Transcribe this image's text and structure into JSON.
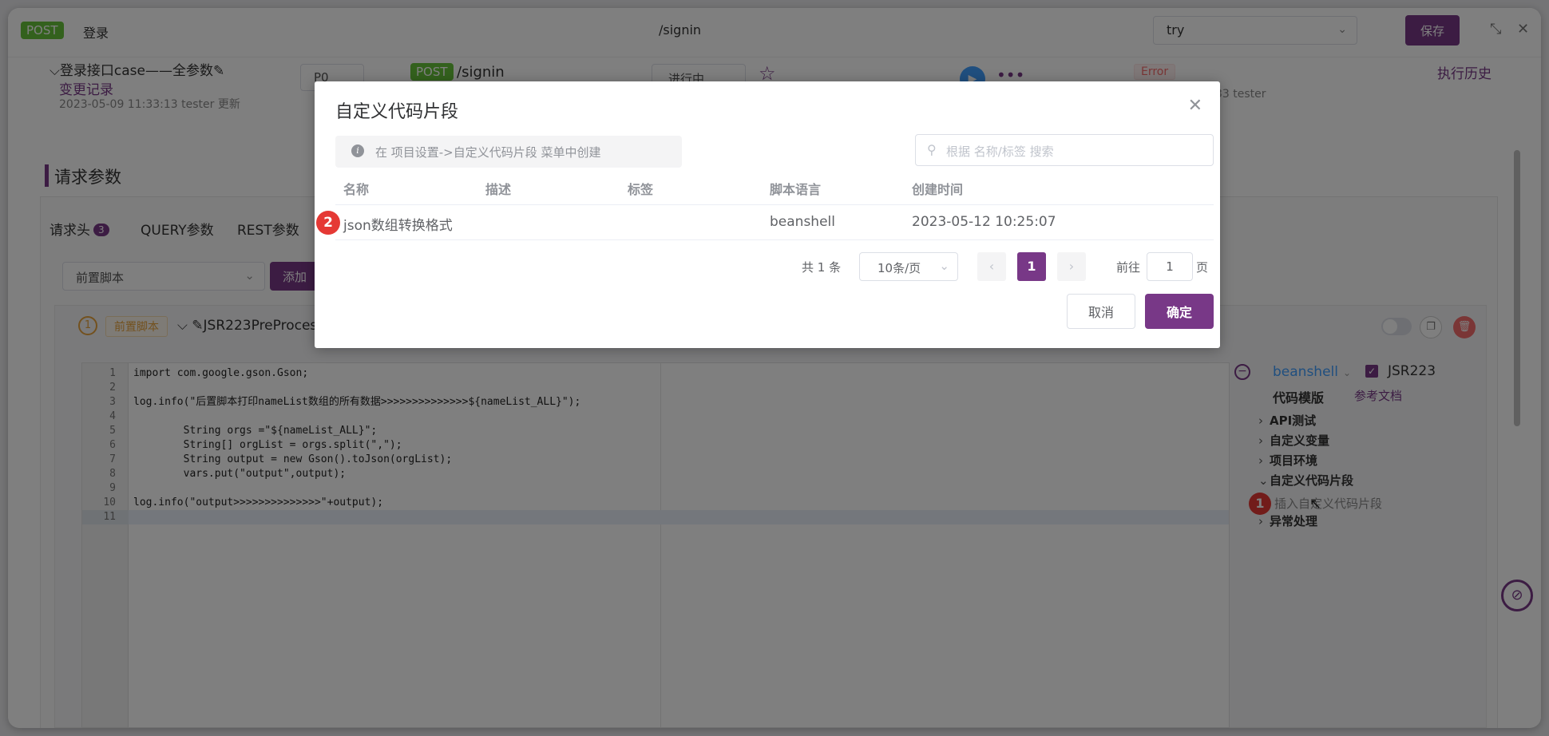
{
  "header": {
    "method": "POST",
    "name": "登录",
    "url": "/signin",
    "env": "try",
    "save": "保存"
  },
  "case": {
    "name": "登录接口case——全参数",
    "edit_icon": "✎",
    "changes": "变更记录",
    "updated": "2023-05-09 11:33:13 tester 更新",
    "priority": "P0",
    "method": "POST",
    "url": "/signin",
    "status": "进行中",
    "result": "Error",
    "history": "执行历史",
    "tester_suffix": "33 tester"
  },
  "params": {
    "title": "请求参数",
    "tabs": [
      {
        "label": "请求头",
        "count": "3"
      },
      {
        "label": "QUERY参数"
      },
      {
        "label": "REST参数"
      }
    ],
    "pre_select": "前置脚本",
    "add": "添加"
  },
  "script": {
    "index": "1",
    "tag": "前置脚本",
    "name": "JSR223PreProcessor"
  },
  "editor_lines": [
    {
      "n": "1",
      "text": "import com.google.gson.Gson;"
    },
    {
      "n": "2",
      "text": ""
    },
    {
      "n": "3",
      "text": "log.info(\"后置脚本打印nameList数组的所有数据>>>>>>>>>>>>>>${nameList_ALL}\");"
    },
    {
      "n": "4",
      "text": ""
    },
    {
      "n": "5",
      "text": "        String orgs =\"${nameList_ALL}\";"
    },
    {
      "n": "6",
      "text": "        String[] orgList = orgs.split(\",\");"
    },
    {
      "n": "7",
      "text": "        String output = new Gson().toJson(orgList);"
    },
    {
      "n": "8",
      "text": "        vars.put(\"output\",output);"
    },
    {
      "n": "9",
      "text": ""
    },
    {
      "n": "10",
      "text": "log.info(\"output>>>>>>>>>>>>>>\"+output);"
    },
    {
      "n": "11",
      "text": ""
    }
  ],
  "side": {
    "language": "beanshell",
    "jsr": "JSR223",
    "template_title": "代码模版",
    "ref_doc": "参考文档",
    "tree": [
      {
        "label": "API测试",
        "caret": "›"
      },
      {
        "label": "自定义变量",
        "caret": "›"
      },
      {
        "label": "项目环境",
        "caret": "›"
      },
      {
        "label": "自定义代码片段",
        "caret": "⌄"
      },
      {
        "label": "异常处理",
        "caret": "›"
      }
    ],
    "insert_snippet": "插入自定义代码片段",
    "step": "1"
  },
  "dialog": {
    "title": "自定义代码片段",
    "info": "在 项目设置->自定义代码片段 菜单中创建",
    "search_placeholder": "根据 名称/标签 搜索",
    "columns": [
      "名称",
      "描述",
      "标签",
      "脚本语言",
      "创建时间"
    ],
    "rows": [
      {
        "name": "json数组转换格式",
        "desc": "",
        "tag": "",
        "lang": "beanshell",
        "created": "2023-05-12 10:25:07"
      }
    ],
    "step": "2",
    "pagination": {
      "total": "共 1 条",
      "page_size": "10条/页",
      "current": "1",
      "goto_prefix": "前往",
      "goto_value": "1",
      "goto_suffix": "页"
    },
    "cancel": "取消",
    "confirm": "确定"
  }
}
